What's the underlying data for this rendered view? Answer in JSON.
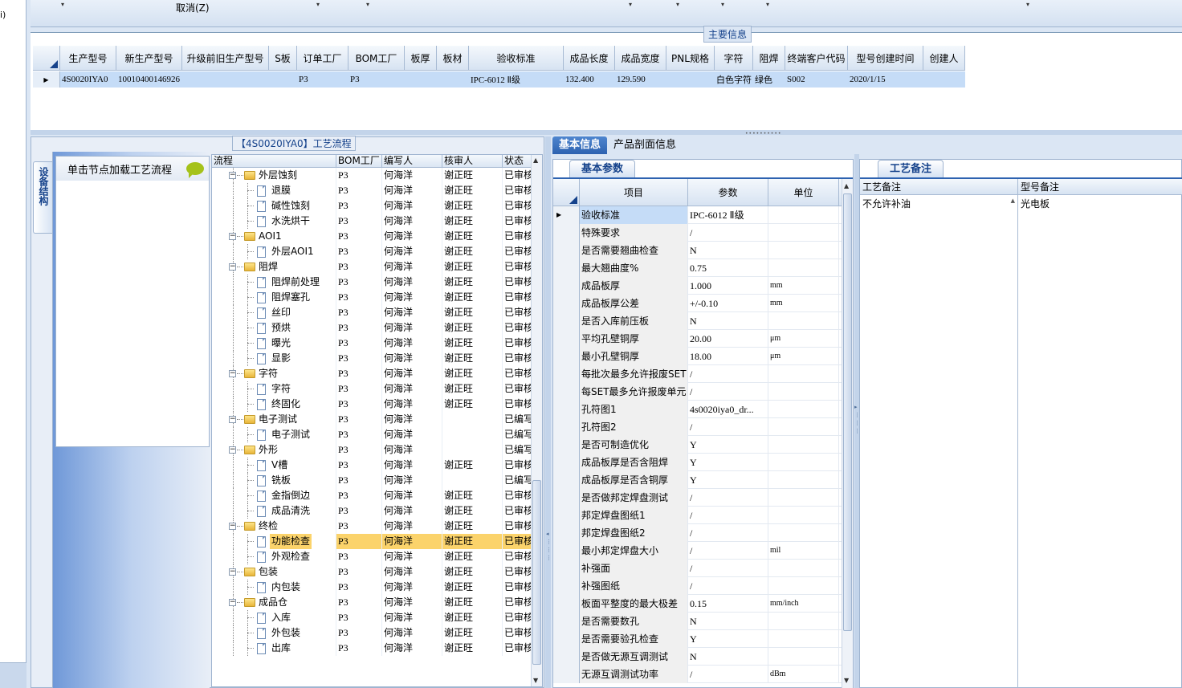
{
  "left_strip": {
    "fragment": "i)"
  },
  "filter_bar": {
    "cancel_label": "取消(Z)",
    "dropdown_glyph": "▾"
  },
  "main_info": {
    "title": "主要信息",
    "columns": [
      "生产型号",
      "新生产型号",
      "升级前旧生产型号",
      "S板",
      "订单工厂",
      "BOM工厂",
      "板厚",
      "板材",
      "验收标准",
      "成品长度",
      "成品宽度",
      "PNL规格",
      "字符",
      "阻焊",
      "终端客户代码",
      "型号创建时间",
      "创建人"
    ],
    "row": [
      "4S0020IYA0",
      "10010400146926",
      "",
      "",
      "P3",
      "P3",
      "",
      "",
      "IPC-6012 Ⅱ级",
      "132.400",
      "129.590",
      "",
      "白色字符",
      "绿色",
      "S002",
      "2020/1/15",
      ""
    ]
  },
  "flow_panel": {
    "title": "【4S0020IYA0】工艺流程",
    "side_tab_label": "设备结构",
    "node_hint": "单击节点加载工艺流程",
    "columns": [
      "流程",
      "BOM工厂",
      "编写人",
      "核审人",
      "状态"
    ],
    "rows": [
      {
        "name": "外层蚀刻",
        "level": 0,
        "bom": "P3",
        "editor": "何海洋",
        "reviewer": "谢正旺",
        "status": "已审核"
      },
      {
        "name": "退膜",
        "level": 1,
        "bom": "P3",
        "editor": "何海洋",
        "reviewer": "谢正旺",
        "status": "已审核"
      },
      {
        "name": "碱性蚀刻",
        "level": 1,
        "bom": "P3",
        "editor": "何海洋",
        "reviewer": "谢正旺",
        "status": "已审核"
      },
      {
        "name": "水洗烘干",
        "level": 1,
        "bom": "P3",
        "editor": "何海洋",
        "reviewer": "谢正旺",
        "status": "已审核"
      },
      {
        "name": "AOI1",
        "level": 0,
        "bom": "P3",
        "editor": "何海洋",
        "reviewer": "谢正旺",
        "status": "已审核"
      },
      {
        "name": "外层AOI1",
        "level": 1,
        "bom": "P3",
        "editor": "何海洋",
        "reviewer": "谢正旺",
        "status": "已审核"
      },
      {
        "name": "阻焊",
        "level": 0,
        "bom": "P3",
        "editor": "何海洋",
        "reviewer": "谢正旺",
        "status": "已审核"
      },
      {
        "name": "阻焊前处理",
        "level": 1,
        "bom": "P3",
        "editor": "何海洋",
        "reviewer": "谢正旺",
        "status": "已审核"
      },
      {
        "name": "阻焊塞孔",
        "level": 1,
        "bom": "P3",
        "editor": "何海洋",
        "reviewer": "谢正旺",
        "status": "已审核"
      },
      {
        "name": "丝印",
        "level": 1,
        "bom": "P3",
        "editor": "何海洋",
        "reviewer": "谢正旺",
        "status": "已审核"
      },
      {
        "name": "预烘",
        "level": 1,
        "bom": "P3",
        "editor": "何海洋",
        "reviewer": "谢正旺",
        "status": "已审核"
      },
      {
        "name": "曝光",
        "level": 1,
        "bom": "P3",
        "editor": "何海洋",
        "reviewer": "谢正旺",
        "status": "已审核"
      },
      {
        "name": "显影",
        "level": 1,
        "bom": "P3",
        "editor": "何海洋",
        "reviewer": "谢正旺",
        "status": "已审核"
      },
      {
        "name": "字符",
        "level": 0,
        "bom": "P3",
        "editor": "何海洋",
        "reviewer": "谢正旺",
        "status": "已审核"
      },
      {
        "name": "字符",
        "level": 1,
        "bom": "P3",
        "editor": "何海洋",
        "reviewer": "谢正旺",
        "status": "已审核"
      },
      {
        "name": "终固化",
        "level": 1,
        "bom": "P3",
        "editor": "何海洋",
        "reviewer": "谢正旺",
        "status": "已审核"
      },
      {
        "name": "电子测试",
        "level": 0,
        "bom": "P3",
        "editor": "何海洋",
        "reviewer": "",
        "status": "已编写"
      },
      {
        "name": "电子测试",
        "level": 1,
        "bom": "P3",
        "editor": "何海洋",
        "reviewer": "",
        "status": "已编写"
      },
      {
        "name": "外形",
        "level": 0,
        "bom": "P3",
        "editor": "何海洋",
        "reviewer": "",
        "status": "已编写"
      },
      {
        "name": "V槽",
        "level": 1,
        "bom": "P3",
        "editor": "何海洋",
        "reviewer": "谢正旺",
        "status": "已审核"
      },
      {
        "name": "铣板",
        "level": 1,
        "bom": "P3",
        "editor": "何海洋",
        "reviewer": "",
        "status": "已编写"
      },
      {
        "name": "金指倒边",
        "level": 1,
        "bom": "P3",
        "editor": "何海洋",
        "reviewer": "谢正旺",
        "status": "已审核"
      },
      {
        "name": "成品清洗",
        "level": 1,
        "bom": "P3",
        "editor": "何海洋",
        "reviewer": "谢正旺",
        "status": "已审核"
      },
      {
        "name": "终检",
        "level": 0,
        "bom": "P3",
        "editor": "何海洋",
        "reviewer": "谢正旺",
        "status": "已审核"
      },
      {
        "name": "功能检查",
        "level": 1,
        "bom": "P3",
        "editor": "何海洋",
        "reviewer": "谢正旺",
        "status": "已审核",
        "selected": true
      },
      {
        "name": "外观检查",
        "level": 1,
        "bom": "P3",
        "editor": "何海洋",
        "reviewer": "谢正旺",
        "status": "已审核"
      },
      {
        "name": "包装",
        "level": 0,
        "bom": "P3",
        "editor": "何海洋",
        "reviewer": "谢正旺",
        "status": "已审核"
      },
      {
        "name": "内包装",
        "level": 1,
        "bom": "P3",
        "editor": "何海洋",
        "reviewer": "谢正旺",
        "status": "已审核"
      },
      {
        "name": "成品仓",
        "level": 0,
        "bom": "P3",
        "editor": "何海洋",
        "reviewer": "谢正旺",
        "status": "已审核"
      },
      {
        "name": "入库",
        "level": 1,
        "bom": "P3",
        "editor": "何海洋",
        "reviewer": "谢正旺",
        "status": "已审核"
      },
      {
        "name": "外包装",
        "level": 1,
        "bom": "P3",
        "editor": "何海洋",
        "reviewer": "谢正旺",
        "status": "已审核"
      },
      {
        "name": "出库",
        "level": 1,
        "bom": "P3",
        "editor": "何海洋",
        "reviewer": "谢正旺",
        "status": "已审核"
      }
    ]
  },
  "right_tabs": [
    "基本信息",
    "产品剖面信息"
  ],
  "basic_params": {
    "title": "基本参数",
    "columns": [
      "项目",
      "参数",
      "单位"
    ],
    "rows": [
      {
        "item": "验收标准",
        "param": "IPC-6012 Ⅱ级",
        "unit": ""
      },
      {
        "item": "特殊要求",
        "param": "/",
        "unit": ""
      },
      {
        "item": "是否需要翘曲检查",
        "param": "N",
        "unit": ""
      },
      {
        "item": "最大翘曲度%",
        "param": "0.75",
        "unit": ""
      },
      {
        "item": "成品板厚",
        "param": "1.000",
        "unit": "mm"
      },
      {
        "item": "成品板厚公差",
        "param": "+/-0.10",
        "unit": "mm"
      },
      {
        "item": "是否入库前压板",
        "param": "N",
        "unit": ""
      },
      {
        "item": "平均孔壁铜厚",
        "param": "20.00",
        "unit": "μm"
      },
      {
        "item": "最小孔壁铜厚",
        "param": "18.00",
        "unit": "μm"
      },
      {
        "item": "每批次最多允许报废SET",
        "param": "/",
        "unit": ""
      },
      {
        "item": "每SET最多允许报废单元",
        "param": "/",
        "unit": ""
      },
      {
        "item": "孔符图1",
        "param": "4s0020iya0_dr...",
        "unit": ""
      },
      {
        "item": "孔符图2",
        "param": "/",
        "unit": ""
      },
      {
        "item": "是否可制造优化",
        "param": "Y",
        "unit": ""
      },
      {
        "item": "成品板厚是否含阻焊",
        "param": "Y",
        "unit": ""
      },
      {
        "item": "成品板厚是否含铜厚",
        "param": "Y",
        "unit": ""
      },
      {
        "item": "是否做邦定焊盘测试",
        "param": "/",
        "unit": ""
      },
      {
        "item": "邦定焊盘图纸1",
        "param": "/",
        "unit": ""
      },
      {
        "item": "邦定焊盘图纸2",
        "param": "/",
        "unit": ""
      },
      {
        "item": "最小邦定焊盘大小",
        "param": "/",
        "unit": "mil"
      },
      {
        "item": "补强面",
        "param": "/",
        "unit": ""
      },
      {
        "item": "补强图纸",
        "param": "/",
        "unit": ""
      },
      {
        "item": "板面平整度的最大极差",
        "param": "0.15",
        "unit": "mm/inch"
      },
      {
        "item": "是否需要数孔",
        "param": "N",
        "unit": ""
      },
      {
        "item": "是否需要验孔检查",
        "param": "Y",
        "unit": ""
      },
      {
        "item": "是否做无源互调测试",
        "param": "N",
        "unit": ""
      },
      {
        "item": "无源互调测试功率",
        "param": "/",
        "unit": "dBm"
      }
    ]
  },
  "craft_notes": {
    "title": "工艺备注",
    "columns": [
      "工艺备注",
      "型号备注"
    ],
    "values": [
      "不允许补油",
      "光电板"
    ]
  }
}
